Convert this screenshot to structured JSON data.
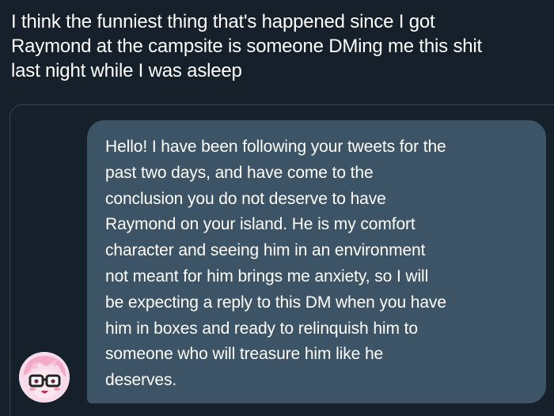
{
  "tweet": {
    "text_lines": [
      "I think the funniest thing that's happened since I got",
      "Raymond at the campsite is someone DMing me this shit",
      "last night while I was asleep"
    ]
  },
  "dm": {
    "message_lines": [
      "Hello! I have been following your tweets for the",
      "past two days, and have come to the",
      "conclusion you do not deserve to have",
      "Raymond on your island. He is my comfort",
      "character and seeing him in an environment",
      "not meant for him brings me anxiety, so I will",
      "be expecting a reply to this DM when you have",
      "him in boxes and ready to relinquish him to",
      "someone who will treasure him like he",
      "deserves."
    ],
    "avatar_icon": "anime-avatar-with-glasses-icon"
  },
  "colors": {
    "background": "#15202b",
    "card_border": "#38444d",
    "bubble": "#3d5466",
    "text": "#ffffff",
    "avatar_bg": "#f6dcea"
  }
}
